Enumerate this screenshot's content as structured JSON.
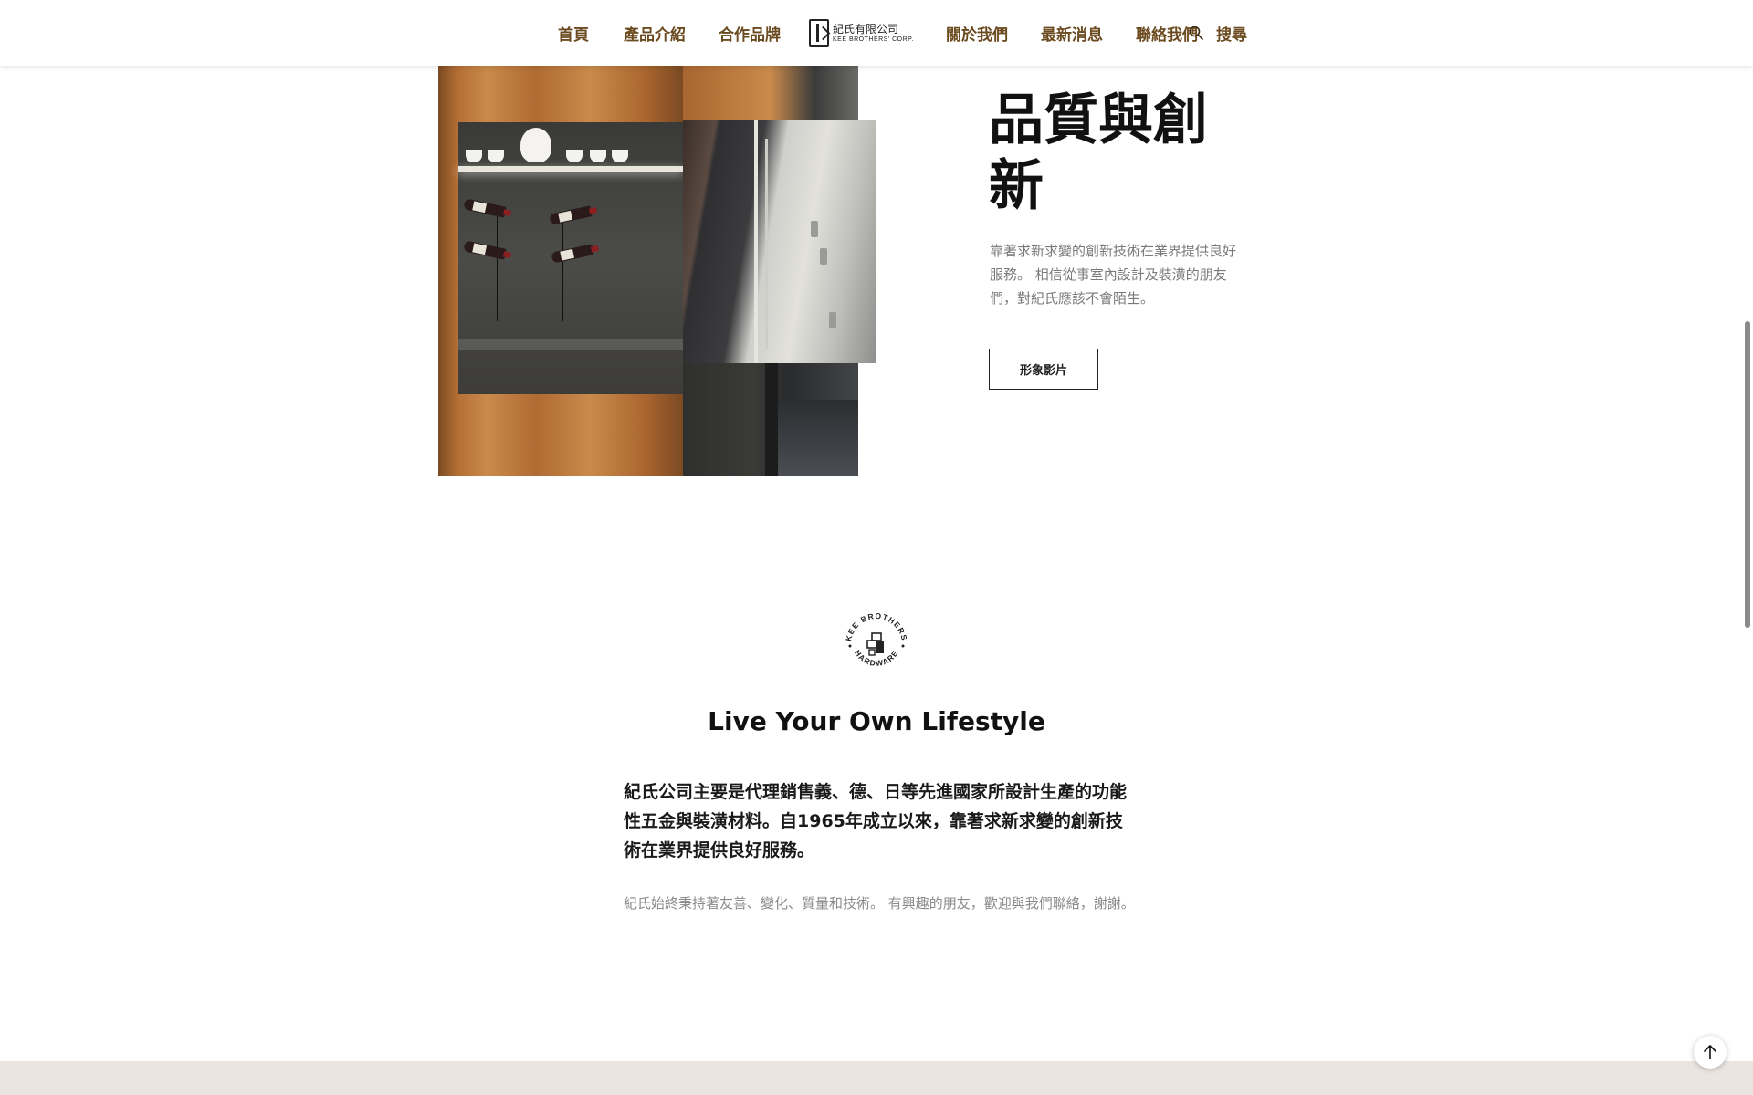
{
  "header": {
    "nav_left": [
      "首頁",
      "產品介紹",
      "合作品牌"
    ],
    "logo": {
      "cn": "紀氏有限公司",
      "en": "KEE BROTHERS' CORP."
    },
    "nav_right": [
      "關於我們",
      "最新消息",
      "聯絡我們"
    ],
    "search_label": "搜尋"
  },
  "hero": {
    "heading": "品質與創新",
    "description": "靠著求新求變的創新技術在業界提供良好服務。 相信從事室內設計及裝潢的朋友們，對紀氏應該不會陌生。",
    "video_button": "形象影片"
  },
  "emblem": {
    "top_text": "KEE BROTHERS",
    "bottom_text": "HARDWARE"
  },
  "about": {
    "title": "Live Your Own Lifestyle",
    "intro": "紀氏公司主要是代理銷售義、德、日等先進國家所設計生產的功能性五金與裝潢材料。自1965年成立以來，靠著求新求變的創新技術在業界提供良好服務。",
    "secondary": "紀氏始終秉持著友善、變化、質量和技術。 有興趣的朋友，歡迎與我們聯絡，謝謝。"
  },
  "icons": {
    "search": "search-icon",
    "to_top": "arrow-up-icon",
    "emblem": "kee-brothers-emblem"
  },
  "colors": {
    "nav_text": "#6b4a1f",
    "footer_band": "#ebe5e2"
  }
}
